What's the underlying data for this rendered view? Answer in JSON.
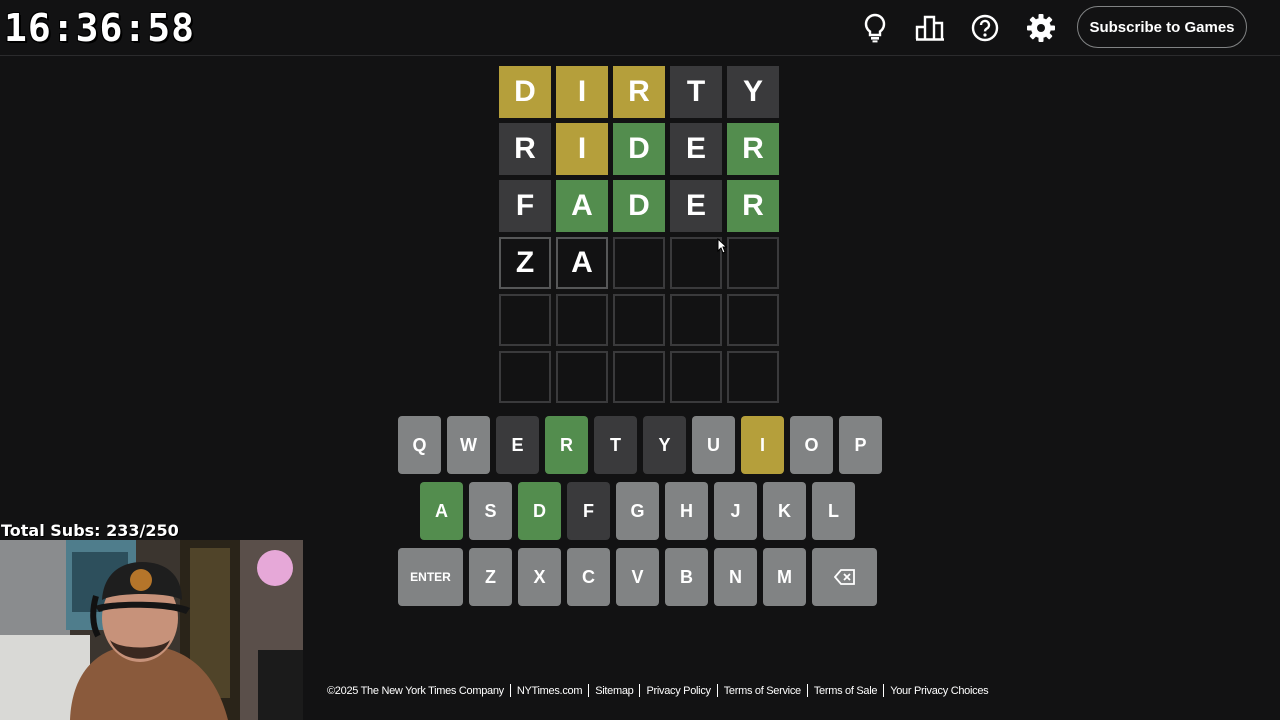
{
  "clock": "16:36:58",
  "header": {
    "subscribe_label": "Subscribe to Games"
  },
  "board": {
    "rows": [
      [
        {
          "letter": "D",
          "state": "present"
        },
        {
          "letter": "I",
          "state": "present"
        },
        {
          "letter": "R",
          "state": "present"
        },
        {
          "letter": "T",
          "state": "absent"
        },
        {
          "letter": "Y",
          "state": "absent"
        }
      ],
      [
        {
          "letter": "R",
          "state": "absent"
        },
        {
          "letter": "I",
          "state": "present"
        },
        {
          "letter": "D",
          "state": "correct"
        },
        {
          "letter": "E",
          "state": "absent"
        },
        {
          "letter": "R",
          "state": "correct"
        }
      ],
      [
        {
          "letter": "F",
          "state": "absent"
        },
        {
          "letter": "A",
          "state": "correct"
        },
        {
          "letter": "D",
          "state": "correct"
        },
        {
          "letter": "E",
          "state": "absent"
        },
        {
          "letter": "R",
          "state": "correct"
        }
      ],
      [
        {
          "letter": "Z",
          "state": "tbd"
        },
        {
          "letter": "A",
          "state": "tbd"
        },
        {
          "letter": "",
          "state": "empty"
        },
        {
          "letter": "",
          "state": "empty"
        },
        {
          "letter": "",
          "state": "empty"
        }
      ],
      [
        {
          "letter": "",
          "state": "empty"
        },
        {
          "letter": "",
          "state": "empty"
        },
        {
          "letter": "",
          "state": "empty"
        },
        {
          "letter": "",
          "state": "empty"
        },
        {
          "letter": "",
          "state": "empty"
        }
      ],
      [
        {
          "letter": "",
          "state": "empty"
        },
        {
          "letter": "",
          "state": "empty"
        },
        {
          "letter": "",
          "state": "empty"
        },
        {
          "letter": "",
          "state": "empty"
        },
        {
          "letter": "",
          "state": "empty"
        }
      ]
    ]
  },
  "keyboard": {
    "rows": [
      [
        {
          "k": "Q",
          "state": "unused"
        },
        {
          "k": "W",
          "state": "unused"
        },
        {
          "k": "E",
          "state": "absent"
        },
        {
          "k": "R",
          "state": "correct"
        },
        {
          "k": "T",
          "state": "absent"
        },
        {
          "k": "Y",
          "state": "absent"
        },
        {
          "k": "U",
          "state": "unused"
        },
        {
          "k": "I",
          "state": "present"
        },
        {
          "k": "O",
          "state": "unused"
        },
        {
          "k": "P",
          "state": "unused"
        }
      ],
      [
        {
          "k": "A",
          "state": "correct"
        },
        {
          "k": "S",
          "state": "unused"
        },
        {
          "k": "D",
          "state": "correct"
        },
        {
          "k": "F",
          "state": "absent"
        },
        {
          "k": "G",
          "state": "unused"
        },
        {
          "k": "H",
          "state": "unused"
        },
        {
          "k": "J",
          "state": "unused"
        },
        {
          "k": "K",
          "state": "unused"
        },
        {
          "k": "L",
          "state": "unused"
        }
      ],
      [
        {
          "k": "ENTER",
          "state": "unused"
        },
        {
          "k": "Z",
          "state": "unused"
        },
        {
          "k": "X",
          "state": "unused"
        },
        {
          "k": "C",
          "state": "unused"
        },
        {
          "k": "V",
          "state": "unused"
        },
        {
          "k": "B",
          "state": "unused"
        },
        {
          "k": "N",
          "state": "unused"
        },
        {
          "k": "M",
          "state": "unused"
        },
        {
          "k": "",
          "state": "unused",
          "icon": "backspace-icon"
        }
      ]
    ]
  },
  "overlay": {
    "subs_label": "Total Subs: 233/250"
  },
  "footer": {
    "links": [
      "©2025 The New York Times Company",
      "NYTimes.com",
      "Sitemap",
      "Privacy Policy",
      "Terms of Service",
      "Terms of Sale",
      "Your Privacy Choices"
    ]
  },
  "icons": {
    "hint": "lightbulb-icon",
    "stats": "bar-chart-icon",
    "help": "help-circle-icon",
    "settings": "gear-icon"
  },
  "colors": {
    "correct": "#538d4e",
    "present": "#b59f3b",
    "absent": "#3a3a3c",
    "key_unused": "#818384",
    "background": "#121213"
  }
}
